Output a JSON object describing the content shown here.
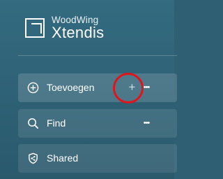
{
  "brand": {
    "line1": "WoodWing",
    "line2": "Xtendis"
  },
  "nav": {
    "items": [
      {
        "label": "Toevoegen",
        "icon": "plus-circle-icon",
        "plus": "+",
        "more": "•••"
      },
      {
        "label": "Find",
        "icon": "search-icon",
        "more": "•••"
      },
      {
        "label": "Shared",
        "icon": "shared-shield-icon"
      }
    ]
  },
  "colors": {
    "background": "#2f5f72",
    "highlight": "#e0141b",
    "text": "#ffffff"
  }
}
